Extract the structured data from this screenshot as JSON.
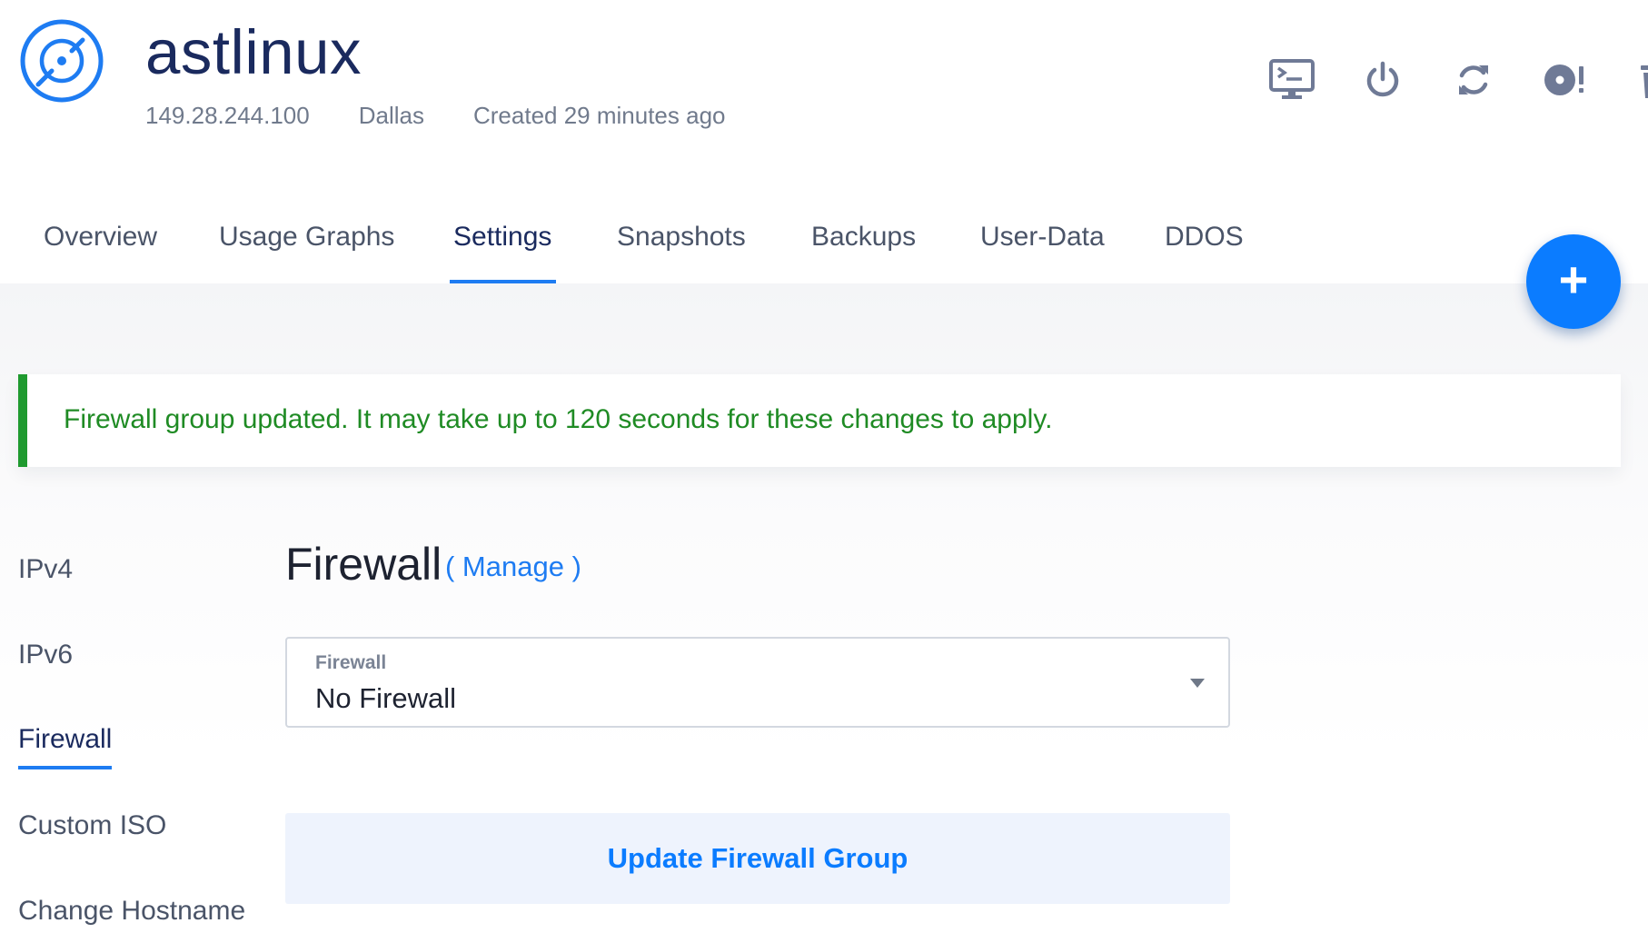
{
  "server": {
    "name": "astlinux",
    "ip": "149.28.244.100",
    "location": "Dallas",
    "created": "Created 29 minutes ago",
    "logo_icon": "disc-icon"
  },
  "toolbar": {
    "items": [
      {
        "name": "console-icon",
        "label": "View Console"
      },
      {
        "name": "power-icon",
        "label": "Server Stop"
      },
      {
        "name": "restart-icon",
        "label": "Server Restart"
      },
      {
        "name": "reinstall-icon",
        "label": "Server Reinstall"
      },
      {
        "name": "trash-icon",
        "label": "Server Destroy"
      }
    ],
    "icon_color": "#6f7a96"
  },
  "tabs": [
    {
      "label": "Overview",
      "active": false
    },
    {
      "label": "Usage Graphs",
      "active": false
    },
    {
      "label": "Settings",
      "active": true
    },
    {
      "label": "Snapshots",
      "active": false
    },
    {
      "label": "Backups",
      "active": false
    },
    {
      "label": "User-Data",
      "active": false
    },
    {
      "label": "DDOS",
      "active": false
    }
  ],
  "fab": {
    "symbol": "+",
    "icon": "plus-icon",
    "color": "#0b7cff"
  },
  "alert": {
    "message": "Firewall group updated. It may take up to 120 seconds for these changes to apply.",
    "type": "success",
    "color": "#1f9a2f"
  },
  "side_nav": [
    {
      "label": "IPv4",
      "active": false
    },
    {
      "label": "IPv6",
      "active": false
    },
    {
      "label": "Firewall",
      "active": true
    },
    {
      "label": "Custom ISO",
      "active": false
    },
    {
      "label": "Change Hostname",
      "active": false
    }
  ],
  "firewall": {
    "title": "Firewall",
    "manage_label": "( Manage )",
    "select_label": "Firewall",
    "select_value": "No Firewall",
    "button_label": "Update Firewall Group"
  },
  "colors": {
    "accent": "#1e7cf2",
    "title": "#1a2a5e",
    "muted": "#707a8c"
  }
}
